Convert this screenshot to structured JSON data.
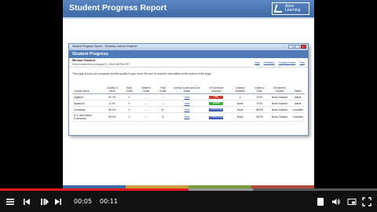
{
  "slide": {
    "title": "Student Progress Report",
    "logo_text_line1": "Apex",
    "logo_text_line2": "Learning"
  },
  "window": {
    "title": "Student Progress Report - Windows Internet Explorer",
    "banner": "Student Progress",
    "student_name": "Michael Student",
    "student_sub": "Sent a moment as of August 11, 2014 6:38 PM PDT",
    "links": [
      "Help",
      "Feedback",
      "Grading Scales",
      "Print"
    ],
    "intro": "This page shows your progress and the quality of your work. Be sure to read the information at the bottom of the page."
  },
  "table": {
    "headers": [
      "Course Name",
      "Quality of Work",
      "Extra Credit",
      "Midterm Grade",
      "Final Grade",
      "Activity Scores and Due Dates",
      "On Schedule Indicator",
      "Overdue Activities",
      "Grade to Date",
      "Enrollment Expires",
      "Status"
    ],
    "rows": [
      [
        "Algebra I",
        "92.7%",
        "0",
        "---",
        "---",
        "View",
        "RED",
        "4",
        "0.0%",
        "None Granted",
        "Active"
      ],
      [
        "Spanish II",
        "5.2%",
        "0",
        "---",
        "---",
        "View",
        "GREEN",
        "None",
        "0.0%",
        "None Granted",
        "Active"
      ],
      [
        "Chemistry",
        "96.0%",
        "0",
        "---",
        "A+",
        "View",
        "COMPLETED",
        "None",
        "96.0%",
        "None Granted",
        "Complete"
      ],
      [
        "U.S. and Global Economics",
        "93.2%",
        "0",
        "---",
        "A",
        "View",
        "COMPLETED",
        "None",
        "93.0%",
        "None Granted",
        "Complete"
      ]
    ]
  },
  "status_colors": {
    "RED": "#d23a2e",
    "GREEN": "#3fae3a",
    "COMPLETED": "#3a55b3"
  },
  "player": {
    "current_time": "00:05",
    "duration": "00:11",
    "progress": 0.5,
    "buffered": 0.67,
    "icons": [
      "menu-icon",
      "skip-back-icon",
      "play-pause-icon",
      "skip-forward-icon",
      "notes-icon",
      "volume-icon",
      "pip-icon",
      "fullscreen-icon"
    ]
  }
}
